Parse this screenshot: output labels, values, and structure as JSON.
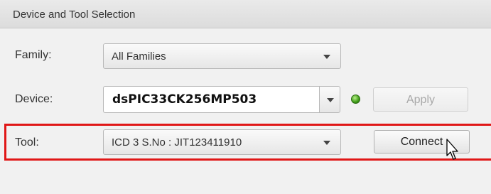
{
  "panel": {
    "title": "Device and Tool Selection"
  },
  "family": {
    "label": "Family:",
    "value": "All Families"
  },
  "device": {
    "label": "Device:",
    "value": "dsPIC33CK256MP503",
    "status_color": "#3e9b16",
    "apply_label": "Apply"
  },
  "tool": {
    "label": "Tool:",
    "value": "ICD 3 S.No : JIT123411910",
    "connect_label": "Connect"
  },
  "colors": {
    "highlight": "#e01717",
    "panel_bg": "#f1f1f1"
  },
  "icons": {
    "dropdown": "chevron-down-icon",
    "status": "status-led-icon",
    "cursor": "mouse-pointer-icon"
  }
}
